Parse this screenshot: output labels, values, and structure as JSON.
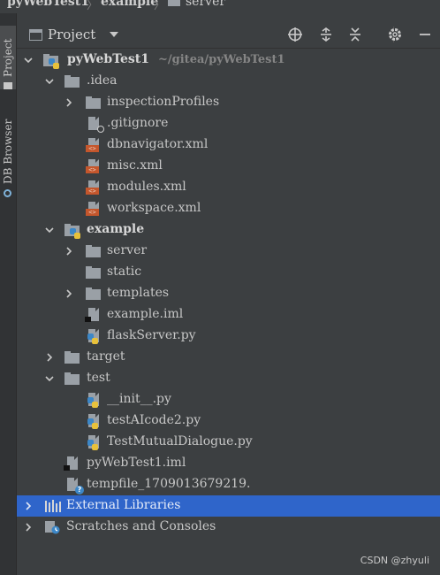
{
  "breadcrumb": {
    "items": [
      "pyWebTest1",
      "example",
      "server"
    ]
  },
  "sidebar": {
    "tabs": [
      {
        "label": "Project",
        "active": true
      },
      {
        "label": "DB Browser",
        "active": false
      }
    ]
  },
  "toolbar": {
    "view_label": "Project",
    "buttons": [
      "crosshair-icon",
      "expand-all-icon",
      "collapse-all-icon",
      "gear-icon",
      "minimize-icon"
    ]
  },
  "tree": {
    "rows": [
      {
        "label": "pyWebTest1",
        "path": "~/gitea/pyWebTest1",
        "type": "module-folder",
        "expanded": true
      },
      {
        "label": ".idea",
        "type": "folder",
        "expanded": true
      },
      {
        "label": "inspectionProfiles",
        "type": "folder",
        "expanded": false
      },
      {
        "label": ".gitignore",
        "type": "ignore-file"
      },
      {
        "label": "dbnavigator.xml",
        "type": "xml-file"
      },
      {
        "label": "misc.xml",
        "type": "xml-file"
      },
      {
        "label": "modules.xml",
        "type": "xml-file"
      },
      {
        "label": "workspace.xml",
        "type": "xml-file"
      },
      {
        "label": "example",
        "type": "python-package",
        "expanded": true
      },
      {
        "label": "server",
        "type": "folder",
        "expanded": false
      },
      {
        "label": "static",
        "type": "folder"
      },
      {
        "label": "templates",
        "type": "folder",
        "expanded": false
      },
      {
        "label": "example.iml",
        "type": "iml-file"
      },
      {
        "label": "flaskServer.py",
        "type": "python-file"
      },
      {
        "label": "target",
        "type": "folder",
        "expanded": false
      },
      {
        "label": "test",
        "type": "folder",
        "expanded": true
      },
      {
        "label": "__init__.py",
        "type": "python-file"
      },
      {
        "label": "testAIcode2.py",
        "type": "python-file"
      },
      {
        "label": "TestMutualDialogue.py",
        "type": "python-file"
      },
      {
        "label": "pyWebTest1.iml",
        "type": "iml-file"
      },
      {
        "label": "tempfile_1709013679219.",
        "type": "unknown-file"
      },
      {
        "label": "External Libraries",
        "type": "libraries",
        "expanded": false,
        "selected": true
      },
      {
        "label": "Scratches and Consoles",
        "type": "scratches",
        "expanded": false
      }
    ]
  },
  "watermark": "CSDN @zhyuli",
  "colors": {
    "background": "#3c3f41",
    "selection": "#2f65ca",
    "xml_badge": "#c4562c",
    "python_blue": "#3c87c7",
    "python_yellow": "#e8c13a"
  }
}
